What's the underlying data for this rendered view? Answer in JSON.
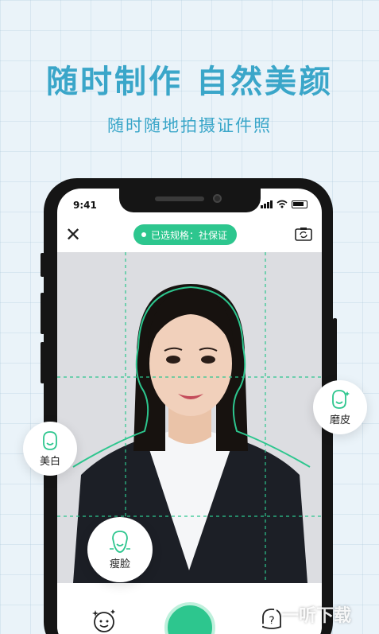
{
  "promo": {
    "headline": "随时制作 自然美颜",
    "subline": "随时随地拍摄证件照"
  },
  "status_bar": {
    "time": "9:41"
  },
  "camera_screen": {
    "spec_label": "已选规格：社保证"
  },
  "beauty_options": {
    "whiten": "美白",
    "smooth": "磨皮",
    "slim": "瘦脸"
  },
  "watermark": {
    "logo": "",
    "text": "一听下载"
  },
  "colors": {
    "accent": "#2dc68e",
    "headline": "#3aa6c9",
    "background": "#eaf3f9"
  },
  "icons": [
    "close-icon",
    "switch-camera-icon",
    "face-beauty-icon",
    "help-icon",
    "shutter-button"
  ]
}
